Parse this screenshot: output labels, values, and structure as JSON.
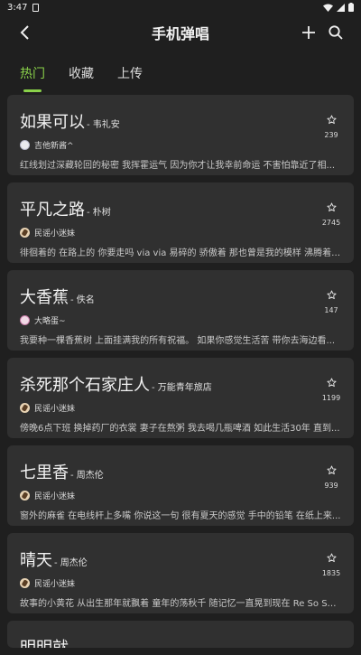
{
  "status": {
    "time": "3:47"
  },
  "appbar": {
    "title": "手机弹唱"
  },
  "tabs": [
    {
      "label": "热门"
    },
    {
      "label": "收藏"
    },
    {
      "label": "上传"
    }
  ],
  "songs": [
    {
      "title": "如果可以",
      "artist": "- 韦礼安",
      "uploader": "吉他新酱^",
      "avatar": "white",
      "desc": "红线划过深藏轮回的秘密 我挥霍运气 因为你才让我幸前命运 不害怕靠近了相...",
      "count": "239"
    },
    {
      "title": "平凡之路",
      "artist": "- 朴树",
      "uploader": "民谣小迷妹",
      "avatar": "guitar",
      "desc": "徘徊着的 在路上的 你要走吗 via via 易碎的 骄傲着 那也曾是我的模样 沸腾着的 ...",
      "count": "2745"
    },
    {
      "title": "大香蕉",
      "artist": "- 佚名",
      "uploader": "大略蛋~",
      "avatar": "pink",
      "desc": "我要种一棵香蕉树 上面挂满我的所有祝福。 如果你感觉生活苦 带你去海边看...",
      "count": "147"
    },
    {
      "title": "杀死那个石家庄人",
      "artist": "- 万能青年旅店",
      "uploader": "民谣小迷妹",
      "avatar": "guitar",
      "desc": "傍晚6点下班 换掉药厂的衣裳 妻子在熬粥 我去喝几瓶啤酒 如此生活30年 直到...",
      "count": "1199"
    },
    {
      "title": "七里香",
      "artist": "- 周杰伦",
      "uploader": "民谣小迷妹",
      "avatar": "guitar",
      "desc": "窗外的麻雀 在电线杆上多嘴 你说这一句 很有夏天的感觉 手中的铅笔 在纸上来...",
      "count": "939"
    },
    {
      "title": "晴天",
      "artist": "- 周杰伦",
      "uploader": "民谣小迷妹",
      "avatar": "guitar",
      "desc": "故事的小黄花 从出生那年就飘着 童年的荡秋千 随记忆一直晃到现在 Re So So S...",
      "count": "1835"
    }
  ],
  "partial_song": {
    "title": "明明就"
  },
  "icons": {
    "back": "back-arrow-icon",
    "add": "plus-icon",
    "search": "search-icon",
    "star": "star-outline-icon"
  },
  "colors": {
    "accent": "#8ad14a",
    "background": "#1f1f1f",
    "card": "#303030"
  }
}
